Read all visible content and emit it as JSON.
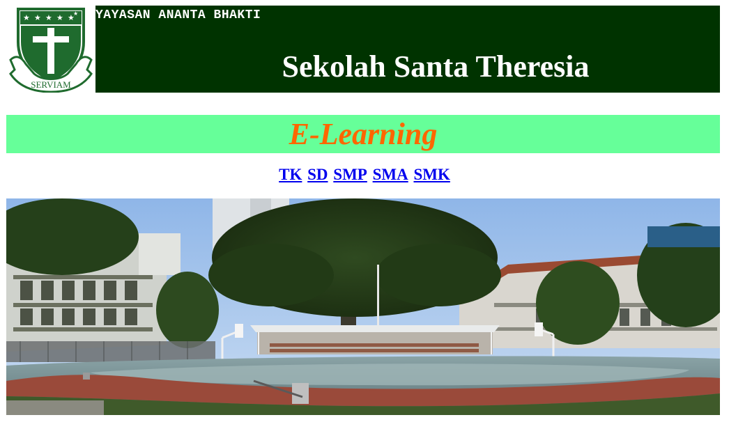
{
  "header": {
    "foundation": "YAYASAN ANANTA BHAKTI",
    "school_name": "Sekolah Santa Theresia",
    "logo_motto": "SERVIAM"
  },
  "banner": {
    "title": "E-Learning"
  },
  "nav": {
    "links": [
      "TK",
      "SD",
      "SMP",
      "SMA",
      "SMK"
    ]
  },
  "colors": {
    "header_bg": "#003300",
    "banner_bg": "#66ff99",
    "banner_text": "#ff6600",
    "link": "#0000ee"
  },
  "icons": {
    "logo": "school-crest-shield-cross-stars"
  }
}
